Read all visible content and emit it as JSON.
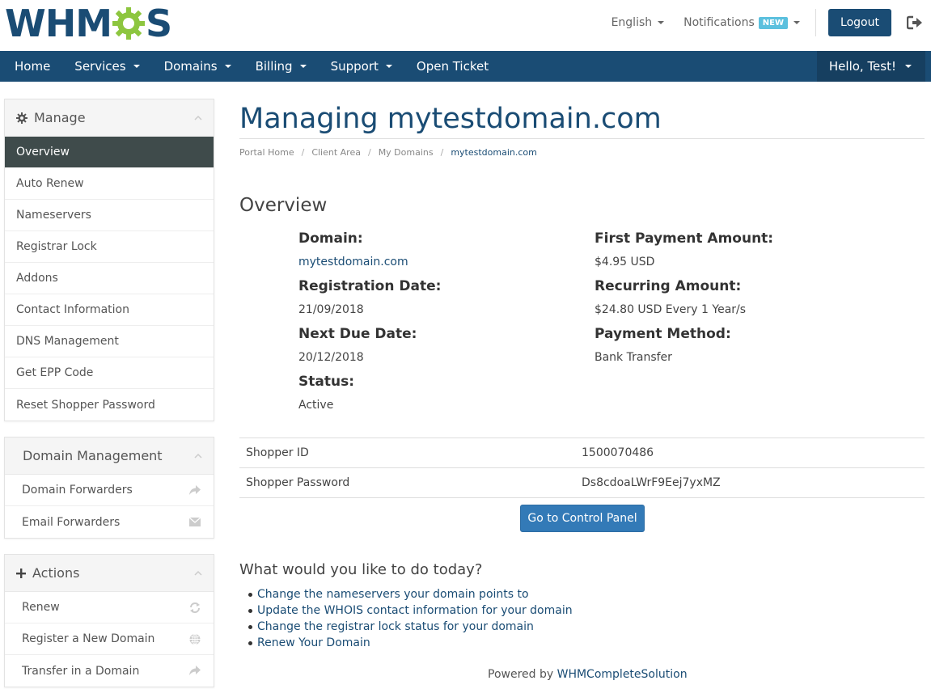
{
  "brand": {
    "logo_text_1": "WHM",
    "logo_text_2": "S",
    "gear_color": "#8dc63f",
    "primary_color": "#1a4c74"
  },
  "header": {
    "language": "English",
    "notifications": "Notifications",
    "notifications_badge": "NEW",
    "logout": "Logout"
  },
  "nav": {
    "items": [
      {
        "label": "Home"
      },
      {
        "label": "Services"
      },
      {
        "label": "Domains"
      },
      {
        "label": "Billing"
      },
      {
        "label": "Support"
      },
      {
        "label": "Open Ticket"
      }
    ],
    "user": "Hello, Test!"
  },
  "sidebar": {
    "manage": {
      "title": "Manage",
      "items": [
        "Overview",
        "Auto Renew",
        "Nameservers",
        "Registrar Lock",
        "Addons",
        "Contact Information",
        "DNS Management",
        "Get EPP Code",
        "Reset Shopper Password"
      ]
    },
    "domain_management": {
      "title": "Domain Management",
      "items": [
        "Domain Forwarders",
        "Email Forwarders"
      ]
    },
    "actions": {
      "title": "Actions",
      "items": [
        "Renew",
        "Register a New Domain",
        "Transfer in a Domain"
      ]
    }
  },
  "main": {
    "title": "Managing mytestdomain.com",
    "breadcrumb": [
      "Portal Home",
      "Client Area",
      "My Domains",
      "mytestdomain.com"
    ],
    "overview_title": "Overview",
    "overview": {
      "domain_label": "Domain:",
      "domain_value": "mytestdomain.com",
      "reg_label": "Registration Date:",
      "reg_value": "21/09/2018",
      "due_label": "Next Due Date:",
      "due_value": "20/12/2018",
      "status_label": "Status:",
      "status_value": "Active",
      "first_label": "First Payment Amount:",
      "first_value": "$4.95 USD",
      "recurring_label": "Recurring Amount:",
      "recurring_value": "$24.80 USD Every 1 Year/s",
      "method_label": "Payment Method:",
      "method_value": "Bank Transfer"
    },
    "info_rows": [
      {
        "label": "Shopper ID",
        "value": "1500070486"
      },
      {
        "label": "Shopper Password",
        "value": "Ds8cdoaLWrF9Eej7yxMZ"
      }
    ],
    "control_panel_button": "Go to Control Panel",
    "todo_title": "What would you like to do today?",
    "todo_links": [
      "Change the nameservers your domain points to",
      "Update the WHOIS contact information for your domain",
      "Change the registrar lock status for your domain",
      "Renew Your Domain"
    ]
  },
  "footer": {
    "prefix": "Powered by",
    "link": "WHMCompleteSolution"
  }
}
